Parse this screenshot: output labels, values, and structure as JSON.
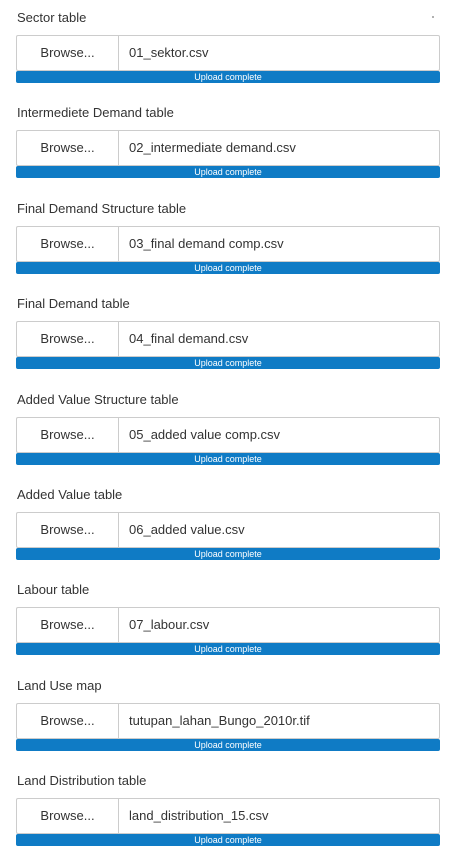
{
  "colors": {
    "progress_fill": "#0f7bc5",
    "border": "#cccccc",
    "text": "#333333"
  },
  "browse_label": "Browse...",
  "status_text": "Upload complete",
  "uploads": [
    {
      "label": "Sector table",
      "file": "01_sektor.csv",
      "progress": 1.0
    },
    {
      "label": "Intermediete Demand table",
      "file": "02_intermediate demand.csv",
      "progress": 1.0
    },
    {
      "label": "Final Demand Structure table",
      "file": "03_final demand comp.csv",
      "progress": 1.0
    },
    {
      "label": "Final Demand table",
      "file": "04_final demand.csv",
      "progress": 1.0
    },
    {
      "label": "Added Value Structure table",
      "file": "05_added value comp.csv",
      "progress": 1.0
    },
    {
      "label": "Added Value table",
      "file": "06_added value.csv",
      "progress": 1.0
    },
    {
      "label": "Labour table",
      "file": "07_labour.csv",
      "progress": 1.0
    },
    {
      "label": "Land Use map",
      "file": "tutupan_lahan_Bungo_2010r.tif",
      "progress": 1.0
    },
    {
      "label": "Land Distribution table",
      "file": "land_distribution_15.csv",
      "progress": 1.0
    }
  ]
}
